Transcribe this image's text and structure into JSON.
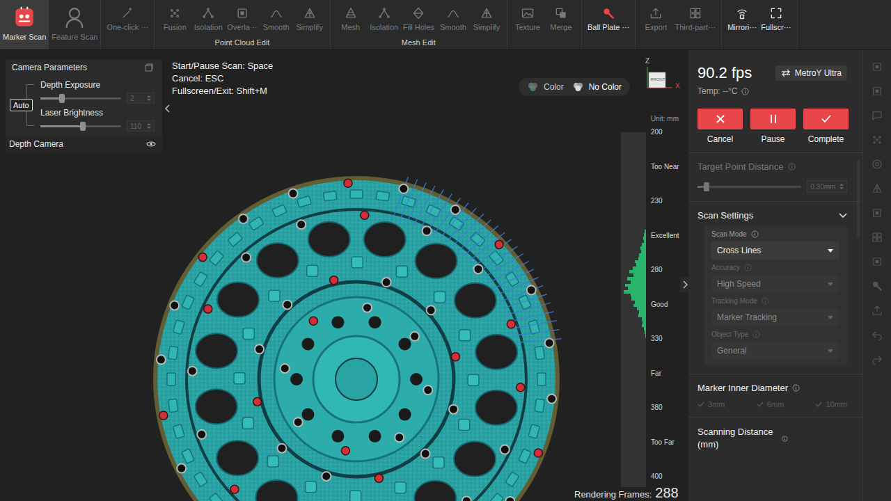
{
  "toolbar": {
    "sections": [
      {
        "title": "",
        "kind": "large",
        "items": [
          {
            "label": "Marker Scan",
            "selected": true,
            "disabled": false,
            "accent": true
          },
          {
            "label": "Feature Scan",
            "selected": false,
            "disabled": true,
            "accent": false
          }
        ]
      },
      {
        "title": "",
        "kind": "small",
        "items": [
          {
            "label": "One-click ···",
            "selected": false,
            "disabled": true,
            "accent": false
          }
        ]
      },
      {
        "title": "Point Cloud Edit",
        "kind": "small",
        "items": [
          {
            "label": "Fusion",
            "selected": false,
            "disabled": true,
            "accent": false
          },
          {
            "label": "Isolation",
            "selected": false,
            "disabled": true,
            "accent": false
          },
          {
            "label": "Overla···",
            "selected": false,
            "disabled": true,
            "accent": false
          },
          {
            "label": "Smooth",
            "selected": false,
            "disabled": true,
            "accent": false
          },
          {
            "label": "Simplify",
            "selected": false,
            "disabled": true,
            "accent": false
          }
        ]
      },
      {
        "title": "Mesh Edit",
        "kind": "small",
        "items": [
          {
            "label": "Mesh",
            "selected": false,
            "disabled": true,
            "accent": false
          },
          {
            "label": "Isolation",
            "selected": false,
            "disabled": true,
            "accent": false
          },
          {
            "label": "Fill Holes",
            "selected": false,
            "disabled": true,
            "accent": false
          },
          {
            "label": "Smooth",
            "selected": false,
            "disabled": true,
            "accent": false
          },
          {
            "label": "Simplify",
            "selected": false,
            "disabled": true,
            "accent": false
          }
        ]
      },
      {
        "title": "",
        "kind": "small",
        "items": [
          {
            "label": "Texture",
            "selected": false,
            "disabled": true,
            "accent": false
          },
          {
            "label": "Merge",
            "selected": false,
            "disabled": true,
            "accent": false
          }
        ]
      },
      {
        "title": "",
        "kind": "small",
        "items": [
          {
            "label": "Ball Plate ···",
            "selected": false,
            "disabled": false,
            "accent": true
          }
        ]
      },
      {
        "title": "",
        "kind": "small",
        "items": [
          {
            "label": "Export",
            "selected": false,
            "disabled": true,
            "accent": false
          },
          {
            "label": "Third-part···",
            "selected": false,
            "disabled": true,
            "accent": false
          }
        ]
      },
      {
        "title": "",
        "kind": "small",
        "items": [
          {
            "label": "Mirrori···",
            "selected": false,
            "disabled": false,
            "accent": false
          },
          {
            "label": "Fullscr···",
            "selected": false,
            "disabled": false,
            "accent": false
          }
        ]
      }
    ]
  },
  "camera_parameters": {
    "title": "Camera Parameters",
    "auto": {
      "label": "Auto",
      "selected": true
    },
    "sliders": [
      {
        "label": "Depth Exposure",
        "value": "2",
        "level": 0.27,
        "disabled": true
      },
      {
        "label": "Laser Brightness",
        "value": "110",
        "level": 0.53,
        "disabled": true
      }
    ],
    "depth_camera": {
      "label": "Depth Camera",
      "visible": true
    }
  },
  "shortcuts": [
    "Start/Pause Scan: Space",
    "Cancel: ESC",
    "Fullscreen/Exit: Shift+M"
  ],
  "color_toggle": [
    {
      "label": "Color",
      "selected": false
    },
    {
      "label": "No Color",
      "selected": true
    }
  ],
  "axis": {
    "z": "Z",
    "x": "X",
    "face": "FRONT"
  },
  "distance_scale": {
    "unit": "Unit: mm",
    "labels": [
      "200",
      "Too Near",
      "230",
      "Excellent",
      "280",
      "Good",
      "330",
      "Far",
      "380",
      "Too Far",
      "400"
    ],
    "histogram": [
      0.05,
      0.08,
      0.12,
      0.1,
      0.18,
      0.25,
      0.22,
      0.3,
      0.35,
      0.5,
      0.45,
      0.6,
      0.75,
      0.55,
      0.85,
      0.7,
      0.95,
      0.8,
      1,
      0.7,
      0.65,
      0.5,
      0.55,
      0.4,
      0.3,
      0.35,
      0.2,
      0.15,
      0.18,
      0.1,
      0.06,
      0.04
    ]
  },
  "rendering_frames": {
    "label": "Rendering Frames:",
    "value": "288"
  },
  "status": {
    "fps": "90.2 fps",
    "device": "MetroY Ultra",
    "temp": "Temp: --°C"
  },
  "scan_actions": [
    {
      "label": "Cancel"
    },
    {
      "label": "Pause"
    },
    {
      "label": "Complete"
    }
  ],
  "target_point_distance": {
    "label": "Target Point Distance",
    "value": "0.30mm",
    "level": 0.09,
    "disabled": true
  },
  "scan_settings": {
    "title": "Scan Settings",
    "expanded": true,
    "fields": [
      {
        "label": "Scan Mode",
        "value": "Cross Lines",
        "disabled": false
      },
      {
        "label": "Accuracy",
        "value": "High Speed",
        "disabled": true
      },
      {
        "label": "Tracking Mode",
        "value": "Marker Tracking",
        "disabled": true
      },
      {
        "label": "Object Type",
        "value": "General",
        "disabled": true
      }
    ]
  },
  "marker_inner_diameter": {
    "label": "Marker Inner Diameter",
    "options": [
      {
        "label": "3mm",
        "checked": true,
        "disabled": true
      },
      {
        "label": "6mm",
        "checked": true,
        "disabled": true
      },
      {
        "label": "10mm",
        "checked": true,
        "disabled": true
      }
    ]
  },
  "scanning_distance": {
    "label": "Scanning Distance (mm)"
  }
}
